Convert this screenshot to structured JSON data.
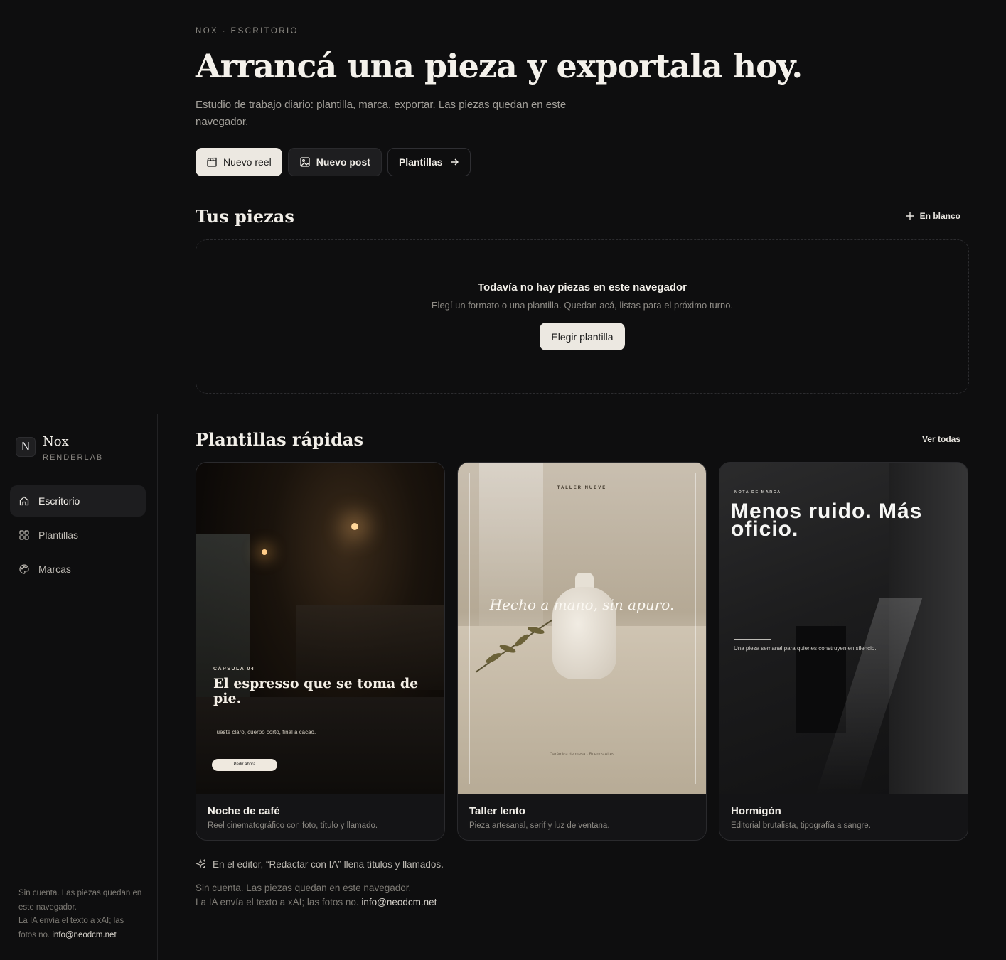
{
  "sidebar": {
    "brand_initial": "N",
    "brand_name": "Nox",
    "brand_sub": "RENDERLAB",
    "items": [
      {
        "label": "Escritorio",
        "icon": "home-icon",
        "active": true
      },
      {
        "label": "Plantillas",
        "icon": "grid-icon",
        "active": false
      },
      {
        "label": "Marcas",
        "icon": "palette-icon",
        "active": false
      }
    ],
    "footer_line1": "Sin cuenta. Las piezas quedan en este navegador.",
    "footer_line2": "La IA envía el texto a xAI; las fotos no.",
    "footer_email": "info@neodcm.net"
  },
  "hero": {
    "eyebrow": "NOX · ESCRITORIO",
    "title": "Arrancá una pieza y exportala hoy.",
    "subtitle": "Estudio de trabajo diario: plantilla, marca, exportar. Las piezas quedan en este navegador.",
    "actions": {
      "new_reel": "Nuevo reel",
      "new_post": "Nuevo post",
      "templates": "Plantillas"
    }
  },
  "pieces": {
    "title": "Tus piezas",
    "blank_link": "En blanco",
    "empty_title": "Todavía no hay piezas en este navegador",
    "empty_sub": "Elegí un formato o una plantilla. Quedan acá, listas para el próximo turno.",
    "empty_button": "Elegir plantilla"
  },
  "quick": {
    "title": "Plantillas rápidas",
    "see_all": "Ver todas",
    "cards": [
      {
        "name": "Noche de café",
        "desc": "Reel cinematográfico con foto, título y llamado.",
        "art": {
          "kicker": "CÁPSULA 04",
          "headline": "El espresso que se toma de pie.",
          "body": "Tueste claro, cuerpo corto, final a cacao.",
          "cta": "Pedir ahora"
        }
      },
      {
        "name": "Taller lento",
        "desc": "Pieza artesanal, serif y luz de ventana.",
        "art": {
          "kicker": "TALLER NUEVE",
          "headline": "Hecho a mano, sin apuro.",
          "foot": "Cerámica de mesa · Buenos Aires"
        }
      },
      {
        "name": "Hormigón",
        "desc": "Editorial brutalista, tipografía a sangre.",
        "art": {
          "kicker": "NOTA DE MARCA",
          "headline": "Menos ruido. Más oficio.",
          "body": "Una pieza semanal para quienes construyen en silencio."
        }
      }
    ]
  },
  "hint": "En el editor, “Redactar con IA” llena títulos y llamados.",
  "footer": {
    "line1": "Sin cuenta. Las piezas quedan en este navegador.",
    "line2": "La IA envía el texto a xAI; las fotos no.",
    "email": "info@neodcm.net"
  },
  "colors": {
    "background": "#0e0e0f",
    "accent_light": "#ece8e1",
    "text_primary": "#f2efe9",
    "text_muted": "#8e8b85"
  }
}
